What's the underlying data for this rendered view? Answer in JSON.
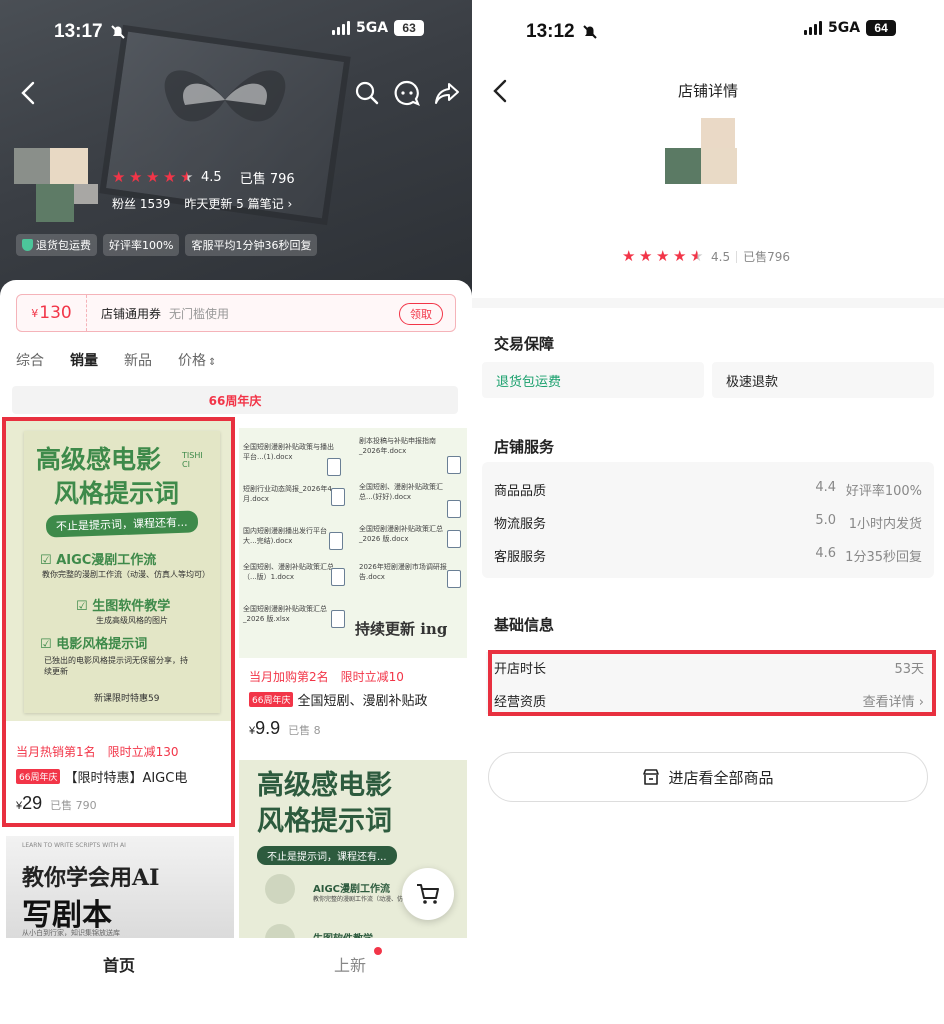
{
  "left": {
    "status_bar": {
      "time": "13:17",
      "network": "5GA",
      "battery": "63"
    },
    "shop": {
      "rating": "4.5",
      "sold": "已售 796",
      "fans": "粉丝 1539",
      "update_note": "昨天更新 5 篇笔记",
      "badges": [
        "退货包运费",
        "好评率100%",
        "客服平均1分钟36秒回复"
      ]
    },
    "coupon": {
      "currency": "¥",
      "amount": "130",
      "name": "店铺通用券",
      "desc": "无门槛使用",
      "claim": "领取"
    },
    "sort_tabs": [
      "综合",
      "销量",
      "新品",
      "价格"
    ],
    "anniversary_label": "66周年庆",
    "products": [
      {
        "poster": {
          "line1": "高级感电影",
          "line2": "风格提示词",
          "corner": "TISHI CI",
          "pill": "不止是提示词，课程还有...",
          "item1": "AIGC漫剧工作流",
          "item1_sub": "教你完整的漫剧工作流（动漫、仿真人等均可）",
          "item2": "生图软件教学",
          "item2_sub": "生成高级风格的图片",
          "item3": "电影风格提示词",
          "item3_sub": "已独出的电影风格提示词无保留分享，持续更新",
          "footer": "新课限时特惠59"
        },
        "rank": "当月热销第1名",
        "promo": "限时立减130",
        "tag": "66周年庆",
        "title": "【限时特惠】AIGC电",
        "price_symbol": "¥",
        "price": "29",
        "sold": "已售 790"
      },
      {
        "poster": {
          "docs": [
            "全国短剧漫剧补贴政策与播出平台...(1).docx",
            "剧本投稿与补贴申报指南_2026年.docx",
            "短剧行业动态简报_2026年4月.docx",
            "全国短剧、漫剧补贴政策汇总...(好好).docx",
            "国内短剧漫剧播出发行平台大...完结).docx",
            "全国短剧漫剧补贴政策汇总_2026 版.docx",
            "全国短剧、漫剧补贴政策汇总（...版）1.docx",
            "2026年短剧漫剧市场调研报告.docx",
            "全国短剧漫剧补贴政策汇总_2026 版.xlsx"
          ],
          "footer": "持续更新 ing"
        },
        "rank": "当月加购第2名",
        "promo": "限时立减10",
        "tag": "66周年庆",
        "title": "全国短剧、漫剧补贴政",
        "price_symbol": "¥",
        "price": "9.9",
        "sold": "已售 8"
      },
      {
        "poster": {
          "top": "LEARN TO WRITE SCRIPTS WITH AI",
          "line1": "教你学会用AI",
          "line2": "写剧本",
          "sub": "从小白到行家，知识集锦放送库"
        }
      },
      {
        "poster": {
          "line1": "高级感电影",
          "line2": "风格提示词",
          "pill": "不止是提示词，课程还有...",
          "item1": "AIGC漫剧工作流",
          "item1_sub": "教你完整的漫剧工作流（动漫、仿真人等均可）",
          "item2": "生图软件教学"
        }
      }
    ],
    "tabbar": [
      "首页",
      "上新"
    ]
  },
  "right": {
    "status_bar": {
      "time": "13:12",
      "network": "5GA",
      "battery": "64"
    },
    "title": "店铺详情",
    "rating": "4.5",
    "sold": "已售796",
    "guarantee": {
      "title": "交易保障",
      "items": [
        "退货包运费",
        "极速退款"
      ]
    },
    "services": {
      "title": "店铺服务",
      "rows": [
        {
          "name": "商品品质",
          "score": "4.4",
          "detail": "好评率100%"
        },
        {
          "name": "物流服务",
          "score": "5.0",
          "detail": "1小时内发货"
        },
        {
          "name": "客服服务",
          "score": "4.6",
          "detail": "1分35秒回复"
        }
      ]
    },
    "basic": {
      "title": "基础信息",
      "rows": [
        {
          "name": "开店时长",
          "value": "53天"
        },
        {
          "name": "经营资质",
          "value": "查看详情"
        }
      ]
    },
    "enter_button": "进店看全部商品"
  },
  "colors": {
    "accent": "#f23548",
    "green": "#3e8a4a",
    "guarantee_green": "#1aa06d",
    "highlight": "#e8303f"
  }
}
